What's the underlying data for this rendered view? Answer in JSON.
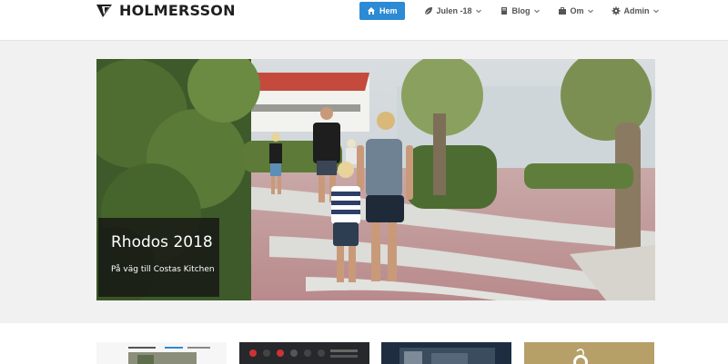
{
  "brand": {
    "name": "HOLMERSSON",
    "logo_icon": "triangle-logo-icon"
  },
  "nav": {
    "active_color": "#2d8ad4",
    "items": [
      {
        "label": "Hem",
        "icon": "home-icon",
        "active": true
      },
      {
        "label": "Julen -18",
        "icon": "leaf-icon",
        "dropdown": true
      },
      {
        "label": "Blog",
        "icon": "book-icon",
        "dropdown": true
      },
      {
        "label": "Om",
        "icon": "briefcase-icon",
        "dropdown": true
      },
      {
        "label": "Admin",
        "icon": "gear-icon",
        "dropdown": true
      }
    ]
  },
  "hero": {
    "title": "Rhodos 2018",
    "subtitle": "På väg till Costas Kitchen"
  },
  "thumbnails": [
    {
      "name": "thumbnail-website"
    },
    {
      "name": "thumbnail-dark-app"
    },
    {
      "name": "thumbnail-night-photo"
    },
    {
      "name": "thumbnail-gold-logo"
    }
  ]
}
